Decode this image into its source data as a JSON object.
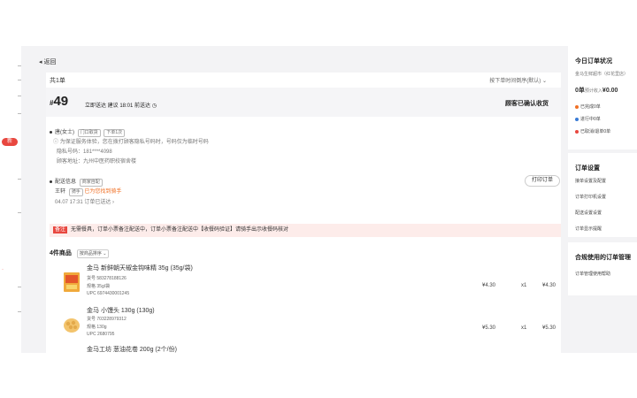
{
  "nav": {
    "back_label": "返回",
    "badge": "新"
  },
  "order_header": {
    "count_label": "共1单",
    "sort_label": "按下单时间倒序(默认)"
  },
  "order": {
    "hash": "#",
    "number": "49",
    "delivery_info": "立即送达  建议 18:01 前送达",
    "status": "顾客已确认收货"
  },
  "customer": {
    "name": "唐(女士)",
    "tag_doorstep": "门口取货",
    "tag_order": "下单1次",
    "privacy_note": "为保证服务体验，您在拨打顾客隐私号码时，号码仅为临时号码",
    "phone_label": "隐私号码：",
    "phone_value": "181****4098",
    "address_label": "顾客地址：",
    "address_value": "九州中医药职校宿舍楼"
  },
  "rider": {
    "label": "配送信息",
    "tag": "商家自配",
    "name": "王轩",
    "name_tag": "骑手",
    "highlight": "已为您找到骑手",
    "time_row": "04.07  17:31  订单已送达"
  },
  "print_button": "打印订单",
  "notice": {
    "label": "备注",
    "text": "无需餐具，订单小票备注配送中，订单小票备注配送中【收餐码验证】请骑手出示收餐码核对"
  },
  "items_header": {
    "count": "4件商品",
    "sort": "按商品排序"
  },
  "items": [
    {
      "name": "金马 新鲜朝天椒金钩味精 35g (35g/袋)",
      "code": "货号 583278188126",
      "spec": "规格 35g/袋",
      "upc": "UPC 6974430001245",
      "price": "¥4.30",
      "qty": "x1",
      "total": "¥4.30"
    },
    {
      "name": "金马 小馒头 130g (130g)",
      "code": "货号 703228979312",
      "spec": "规格 130g",
      "upc": "UPC 2680795",
      "price": "¥5.30",
      "qty": "x1",
      "total": "¥5.30"
    },
    {
      "name": "金马工坊 葱油花卷 200g (2个/份)"
    }
  ],
  "right": {
    "status_title": "今日订单状况",
    "status_sub": "金马生鲜超市（红花里店）",
    "today_count": "0单",
    "today_income_label": "预计收入",
    "today_income": "¥0.00",
    "stats": [
      {
        "label": "已完成0单",
        "color": "#f07025"
      },
      {
        "label": "进行中0单",
        "color": "#3a7bd5"
      },
      {
        "label": "已取消/退单0单",
        "color": "#e8473f"
      }
    ],
    "settings_title": "订单设置",
    "settings_links": [
      "接单设置及配置",
      "订单打印机设置",
      "配送设置设置",
      "订单显示提醒"
    ],
    "help_title": "合规使用的订单管理",
    "help_link": "订单管理使用帮助"
  }
}
